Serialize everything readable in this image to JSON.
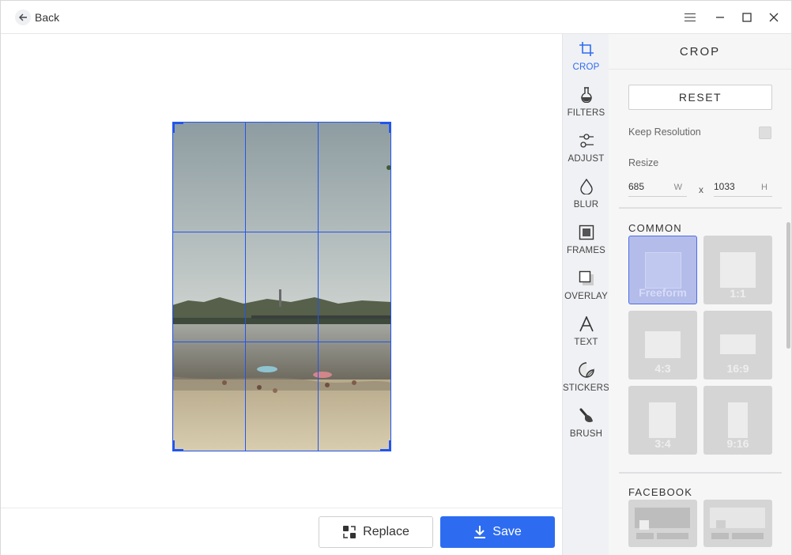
{
  "titlebar": {
    "back_label": "Back",
    "icons": {
      "menu": "hamburger-icon",
      "minimize": "minimize-icon",
      "maximize": "maximize-icon",
      "close": "close-icon"
    }
  },
  "tools": [
    {
      "label": "CROP",
      "icon": "crop-icon",
      "active": true
    },
    {
      "label": "FILTERS",
      "icon": "filters-icon",
      "active": false
    },
    {
      "label": "ADJUST",
      "icon": "adjust-icon",
      "active": false
    },
    {
      "label": "BLUR",
      "icon": "blur-icon",
      "active": false
    },
    {
      "label": "FRAMES",
      "icon": "frames-icon",
      "active": false
    },
    {
      "label": "OVERLAY",
      "icon": "overlay-icon",
      "active": false
    },
    {
      "label": "TEXT",
      "icon": "text-icon",
      "active": false
    },
    {
      "label": "STICKERS",
      "icon": "stickers-icon",
      "active": false
    },
    {
      "label": "BRUSH",
      "icon": "brush-icon",
      "active": false
    }
  ],
  "panel": {
    "title": "CROP",
    "reset_label": "RESET",
    "keep_resolution_label": "Keep Resolution",
    "keep_resolution_checked": false,
    "resize_label": "Resize",
    "width_value": "685",
    "width_unit": "W",
    "times": "x",
    "height_value": "1033",
    "height_unit": "H",
    "common_title": "COMMON",
    "ratios": [
      {
        "label": "Freeform",
        "active": true
      },
      {
        "label": "1:1",
        "active": false
      },
      {
        "label": "4:3",
        "active": false
      },
      {
        "label": "16:9",
        "active": false
      },
      {
        "label": "3:4",
        "active": false
      },
      {
        "label": "9:16",
        "active": false
      }
    ],
    "facebook_title": "FACEBOOK"
  },
  "bottom": {
    "replace_label": "Replace",
    "save_label": "Save"
  },
  "colors": {
    "accent": "#2d6cf0",
    "crop_grid": "#2255ee",
    "rail_bg": "#f0f1f4",
    "panel_bg": "#f6f6f7"
  }
}
